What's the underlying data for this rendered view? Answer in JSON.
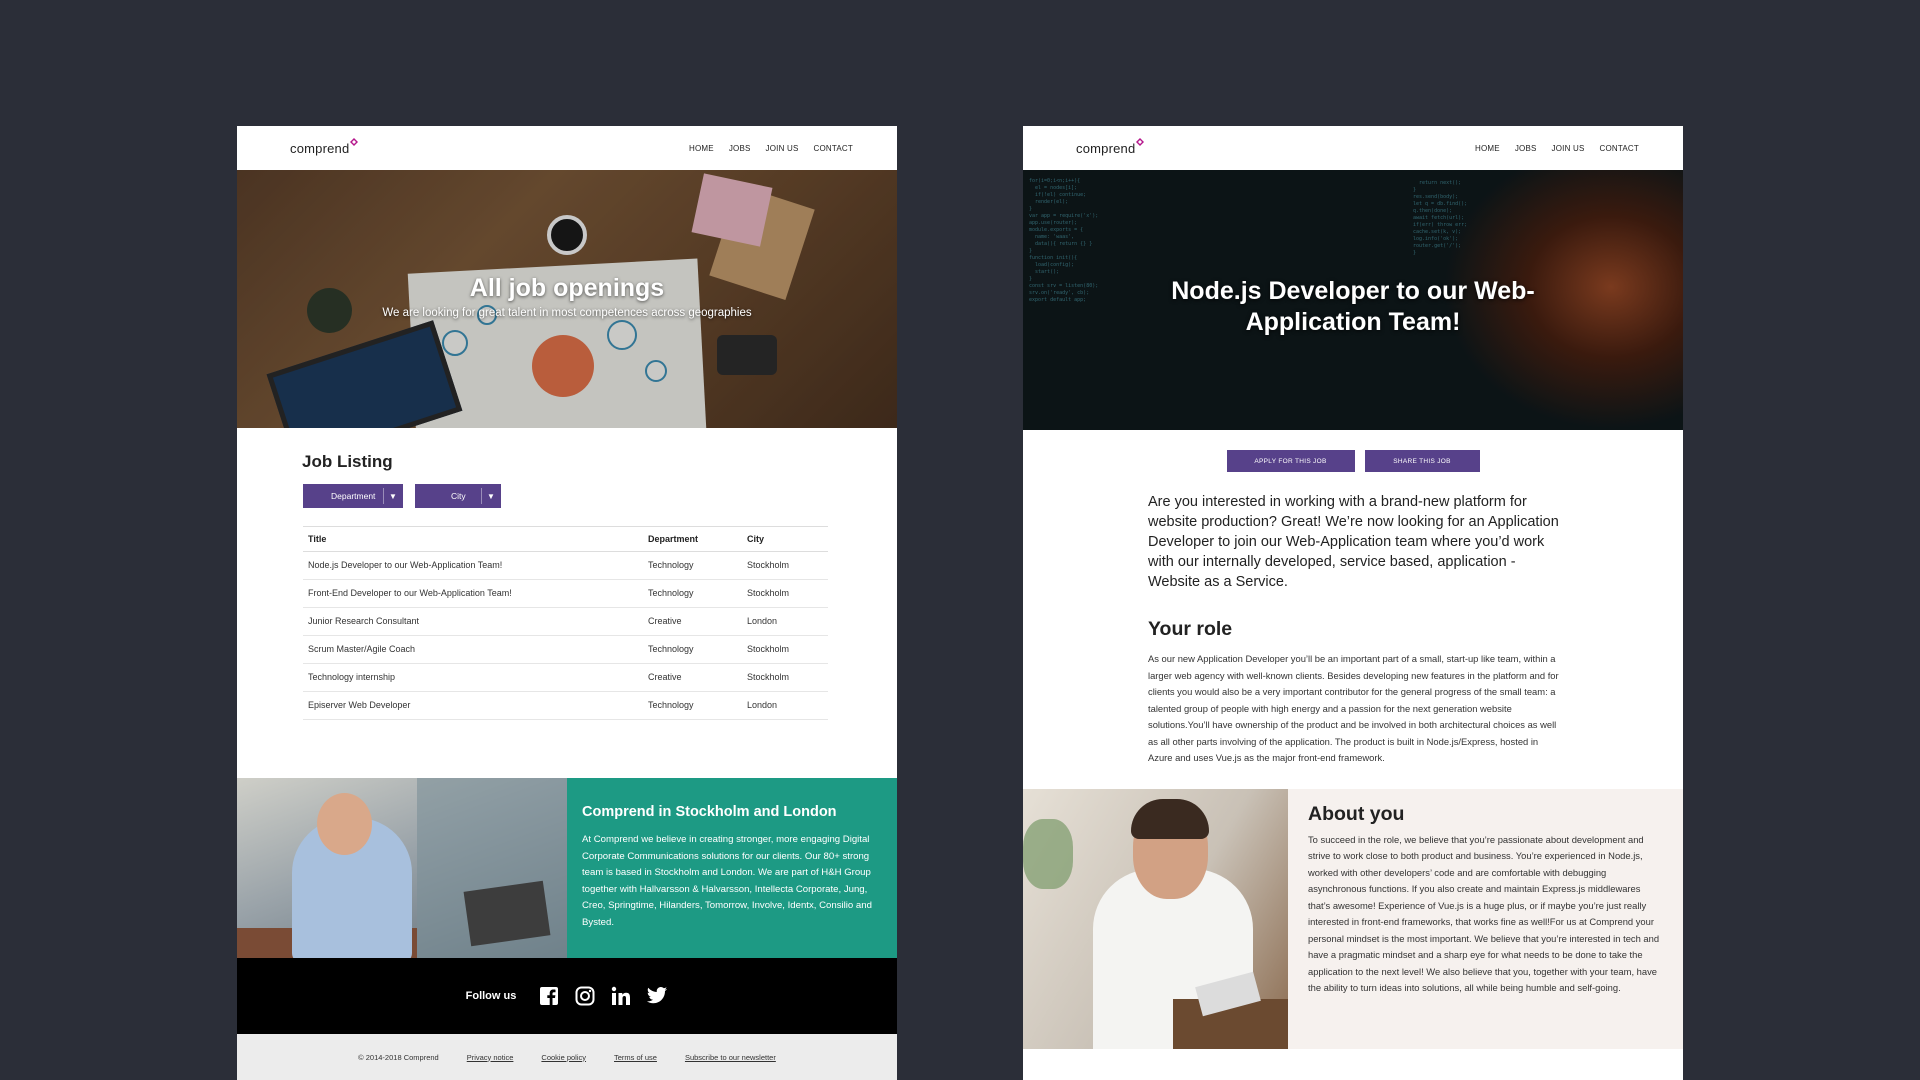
{
  "brand": {
    "logo_text": "comprend",
    "accent": "#b5178c"
  },
  "nav": [
    "HOME",
    "JOBS",
    "JOIN US",
    "CONTACT"
  ],
  "listing_page": {
    "hero": {
      "title": "All job openings",
      "subtitle": "We are looking for great talent in most competences across geographies"
    },
    "section_title": "Job Listing",
    "filters": {
      "department": "Department",
      "city": "City"
    },
    "table": {
      "headers": [
        "Title",
        "Department",
        "City"
      ],
      "rows": [
        [
          "Node.js Developer to our Web-Application Team!",
          "Technology",
          "Stockholm"
        ],
        [
          "Front-End Developer to our Web-Application Team!",
          "Technology",
          "Stockholm"
        ],
        [
          "Junior Research Consultant",
          "Creative",
          "London"
        ],
        [
          "Scrum Master/Agile Coach",
          "Technology",
          "Stockholm"
        ],
        [
          "Technology internship",
          "Creative",
          "Stockholm"
        ],
        [
          "Episerver Web Developer",
          "Technology",
          "London"
        ]
      ]
    },
    "promo": {
      "title": "Comprend in Stockholm and London",
      "text": "At Comprend we believe in creating stronger, more engaging Digital Corporate Communications solutions for our clients. Our 80+ strong team is based in Stockholm and London. We are part of H&H Group together with Hallvarsson & Halvarsson, Intellecta Corporate, Jung, Creo, Springtime, Hilanders, Tomorrow, Involve, Identx, Consilio and Bysted."
    },
    "follow": {
      "label": "Follow us",
      "icons": [
        "facebook-icon",
        "instagram-icon",
        "linkedin-icon",
        "twitter-icon"
      ]
    },
    "footer": {
      "copyright": "© 2014-2018 Comprend",
      "links": [
        "Privacy notice",
        "Cookie policy",
        "Terms of use",
        "Subscribe to our newsletter"
      ]
    }
  },
  "job_page": {
    "hero_title": "Node.js Developer to our Web-Application Team!",
    "buttons": {
      "apply": "APPLY FOR THIS JOB",
      "share": "SHARE THIS JOB"
    },
    "intro": "Are you interested in working with a brand-new platform for website production? Great! We’re now looking for an Application Developer to join our Web-Application team where you’d work with our internally developed, service based, application - Website as a Service.",
    "role_title": "Your role",
    "role_text": "As our new Application Developer you’ll be an important part of a small, start-up like team, within a larger web agency with well-known clients. Besides developing new features in the platform and for clients you would also be a very important contributor for the general progress of the small team: a talented group of people with high energy and a passion for the next generation website solutions.You’ll have ownership of the product and be involved in both architectural choices as well as all other parts involving of the application. The product is built in Node.js/Express, hosted in Azure and uses Vue.js as the major front-end framework.",
    "about_title": "About you",
    "about_text": "To succeed in the role, we believe that you’re passionate about development and strive to work close to both product and business. You’re experienced in Node.js, worked with other developers’ code and are comfortable with debugging asynchronous functions. If you also create and maintain Express.js middlewares that’s awesome! Experience of Vue.js is a huge plus, or if maybe you’re just really interested in front-end frameworks, that works fine as well!For us at Comprend your personal mindset is the most important. We believe that you’re interested in tech and have a pragmatic mindset and a sharp eye for what needs to be done to take the application to the next level! We also believe that you, together with your team, have the ability to turn ideas into solutions, all while being humble and self-going."
  },
  "colors": {
    "background": "#2b2e38",
    "button": "#57418a",
    "promo": "#1d9a84",
    "about_bg": "#f6f1ee"
  }
}
